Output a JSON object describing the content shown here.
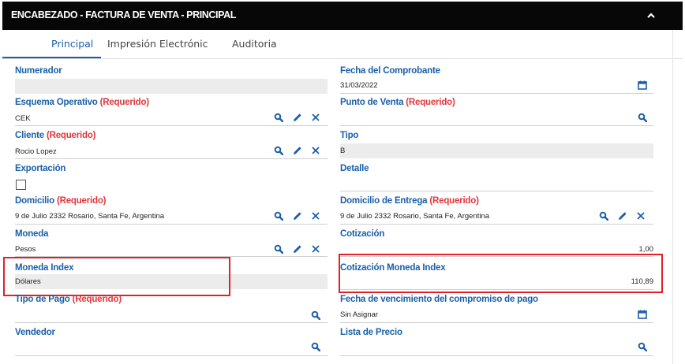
{
  "header": {
    "title": "ENCABEZADO - FACTURA DE VENTA - PRINCIPAL",
    "collapse_icon": "chevron-up-icon"
  },
  "tabs": [
    {
      "label": "Principal",
      "active": true
    },
    {
      "label": "Impresión Electrónic",
      "active": false
    },
    {
      "label": "Auditoria",
      "active": false
    }
  ],
  "required_text": "(Requerido)",
  "fields": {
    "numerador": {
      "label": "Numerador",
      "value": ""
    },
    "esquema": {
      "label": "Esquema Operativo",
      "value": "CEK"
    },
    "cliente": {
      "label": "Cliente",
      "value": "Rocio Lopez"
    },
    "exportacion": {
      "label": "Exportación",
      "checked": false
    },
    "domicilio": {
      "label": "Domicilio",
      "value": "9 de Julio 2332  Rosario, Santa Fe, Argentina"
    },
    "moneda": {
      "label": "Moneda",
      "value": "Pesos"
    },
    "moneda_index": {
      "label": "Moneda Index",
      "value": "Dólares"
    },
    "tipo_pago": {
      "label": "Tipo de Pago",
      "value": ""
    },
    "vendedor": {
      "label": "Vendedor",
      "value": ""
    },
    "fecha_comprobante": {
      "label": "Fecha del Comprobante",
      "value": "31/03/2022"
    },
    "punto_venta": {
      "label": "Punto de Venta",
      "value": ""
    },
    "tipo": {
      "label": "Tipo",
      "value": "B"
    },
    "detalle": {
      "label": "Detalle",
      "value": ""
    },
    "domicilio_entrega": {
      "label": "Domicilio de Entrega",
      "value": "9 de Julio 2332  Rosario, Santa Fe, Argentina"
    },
    "cotizacion": {
      "label": "Cotización",
      "value": "1,00"
    },
    "cotizacion_index": {
      "label": "Cotización Moneda Index",
      "value": "110,89"
    },
    "fecha_vencimiento": {
      "label": "Fecha de vencimiento del compromiso de pago",
      "value": "Sin Asignar"
    },
    "lista_precio": {
      "label": "Lista de Precio",
      "value": ""
    }
  },
  "colors": {
    "accent": "#1a5fa8",
    "required": "#e0363c",
    "highlight": "#e0202a",
    "header_bg": "#070707"
  }
}
